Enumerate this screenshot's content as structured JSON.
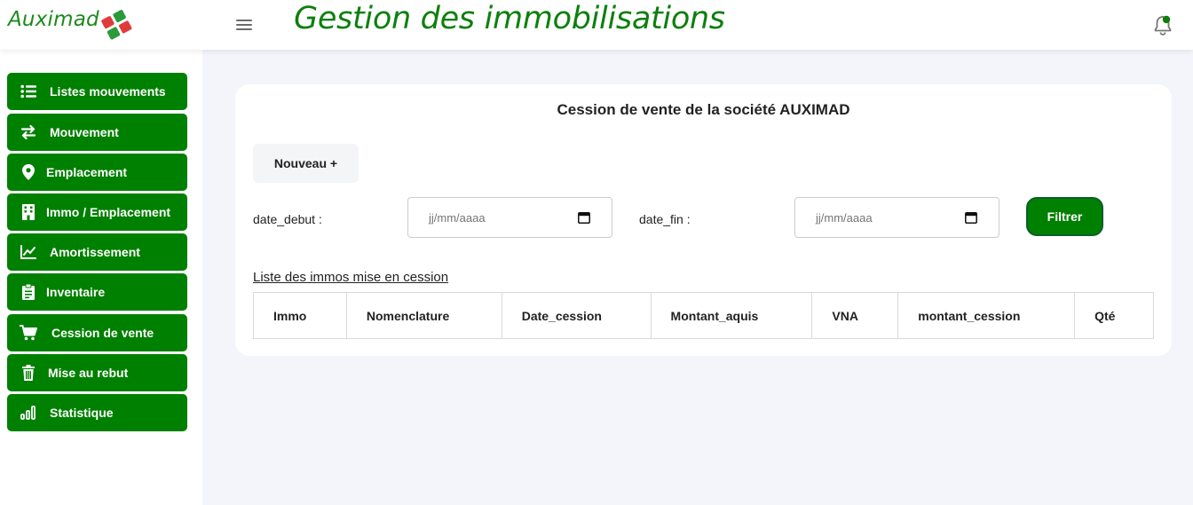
{
  "header": {
    "logo_text": "Auximad",
    "title": "Gestion des immobilisations",
    "menu_icon": "hamburger-icon",
    "notification_icon": "bell-icon",
    "notification_dot_color": "#0b7d0b"
  },
  "colors": {
    "accent": "#008000",
    "title_green": "#0d800d",
    "background": "#f3f5fb",
    "logo_red": "#e03b3b"
  },
  "sidebar": {
    "items": [
      {
        "label": "Listes mouvements",
        "icon": "list-icon"
      },
      {
        "label": "Mouvement",
        "icon": "swap-arrows-icon"
      },
      {
        "label": "Emplacement",
        "icon": "map-pin-icon"
      },
      {
        "label": "Immo / Emplacement",
        "icon": "building-icon"
      },
      {
        "label": "Amortissement",
        "icon": "line-chart-icon"
      },
      {
        "label": "Inventaire",
        "icon": "clipboard-icon"
      },
      {
        "label": "Cession de vente",
        "icon": "cart-icon"
      },
      {
        "label": "Mise au rebut",
        "icon": "trash-icon"
      },
      {
        "label": "Statistique",
        "icon": "bar-chart-icon"
      }
    ]
  },
  "main": {
    "card_title": "Cession de vente de la société AUXIMAD",
    "new_button": "Nouveau +",
    "date_debut_label": "date_debut :",
    "date_debut_placeholder": "jj/mm/aaaa",
    "date_fin_label": "date_fin :",
    "date_fin_placeholder": "jj/mm/aaaa",
    "filter_button": "Filtrer",
    "list_title": "Liste des immos mise en cession",
    "table": {
      "columns": [
        "Immo",
        "Nomenclature",
        "Date_cession",
        "Montant_aquis",
        "VNA",
        "montant_cession",
        "Qté"
      ]
    }
  }
}
